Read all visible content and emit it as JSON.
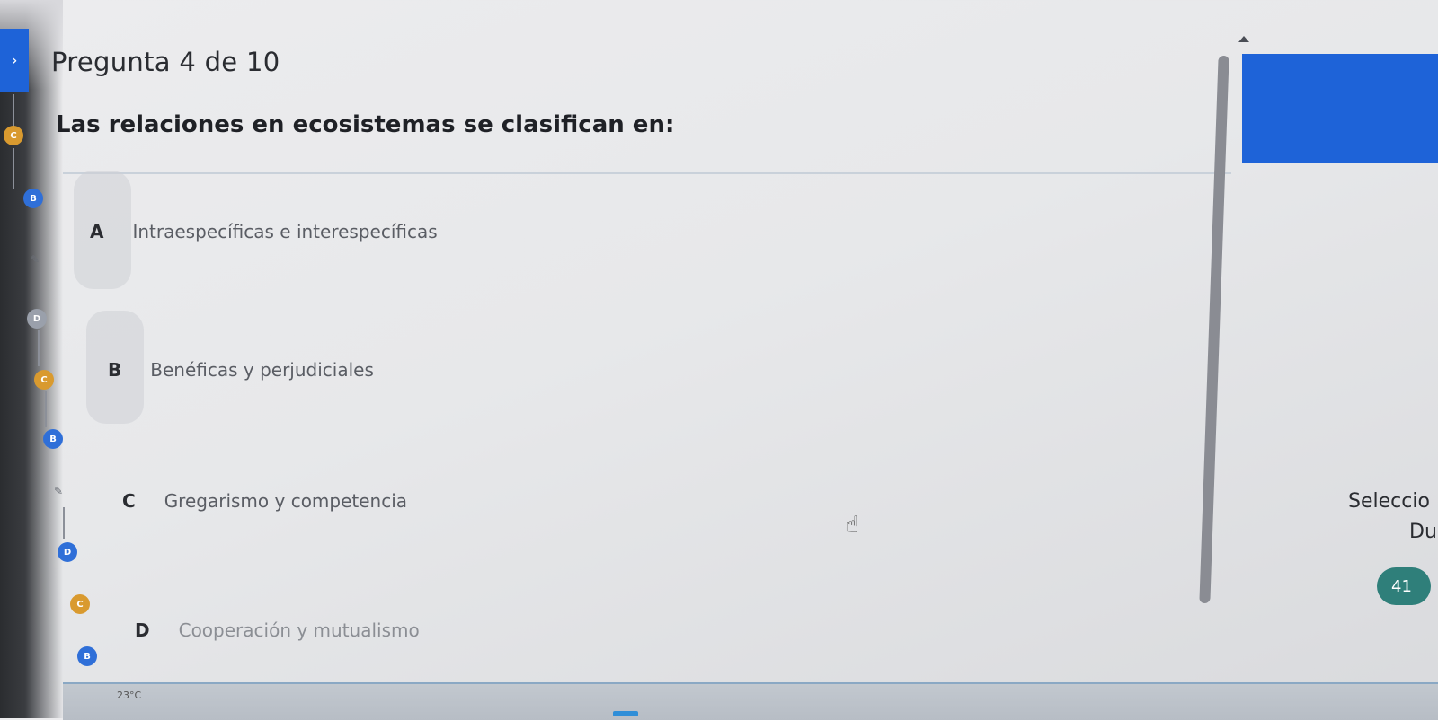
{
  "header": {
    "question_count": "Pregunta 4 de 10"
  },
  "question": {
    "text": "Las relaciones en ecosistemas se clasifican en:"
  },
  "options": [
    {
      "letter": "A",
      "label": "Intraespecíficas e interespecíficas"
    },
    {
      "letter": "B",
      "label": "Benéficas y perjudiciales"
    },
    {
      "letter": "C",
      "label": "Gregarismo y competencia"
    },
    {
      "letter": "D",
      "label": "Cooperación y mutualismo"
    }
  ],
  "right_panel": {
    "select_text": "Seleccio",
    "sub_text": "Du",
    "badge": "41"
  },
  "taskbar": {
    "temperature": "23°C"
  },
  "colors": {
    "accent_blue": "#1e63d8",
    "badge_teal": "#2f7f7a"
  }
}
